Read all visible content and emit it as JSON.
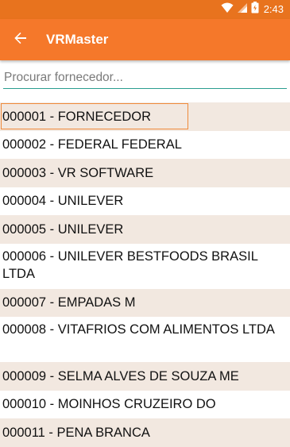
{
  "status_bar": {
    "time": "2:43",
    "icons": [
      "wifi-icon",
      "signal-icon",
      "battery-icon"
    ]
  },
  "app_bar": {
    "title": "VRMaster",
    "back_icon": "arrow-back-icon"
  },
  "search": {
    "placeholder": "Procurar fornecedor..."
  },
  "suppliers": [
    {
      "label": "000001 - FORNECEDOR"
    },
    {
      "label": "000002 - FEDERAL FEDERAL"
    },
    {
      "label": "000003 - VR SOFTWARE"
    },
    {
      "label": "000004 - UNILEVER"
    },
    {
      "label": "000005 - UNILEVER"
    },
    {
      "label": "000006 - UNILEVER BESTFOODS BRASIL LTDA"
    },
    {
      "label": "000007 - EMPADAS M"
    },
    {
      "label": "000008 - VITAFRIOS COM ALIMENTOS LTDA"
    },
    {
      "label": "000009 - SELMA ALVES DE SOUZA ME"
    },
    {
      "label": "000010 - MOINHOS CRUZEIRO DO"
    },
    {
      "label": "000011 - PENA BRANCA"
    }
  ],
  "colors": {
    "status_bar": "#e8731e",
    "app_bar": "#f5782a",
    "row_tint": "#f2e8e0",
    "search_underline": "#2a9d8f",
    "selection_border": "#ef8a3a"
  }
}
